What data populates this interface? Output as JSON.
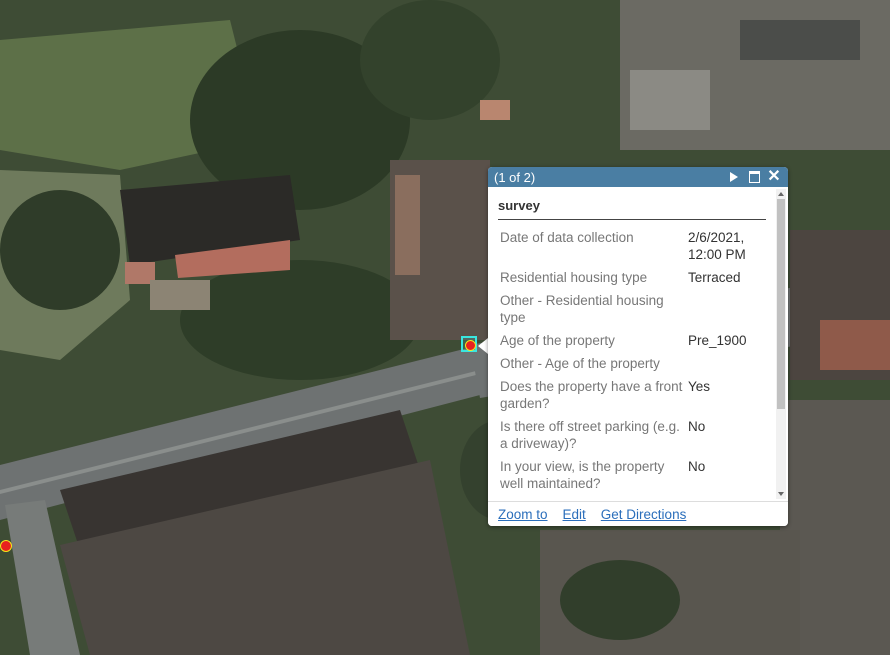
{
  "popup": {
    "count_label": "(1 of 2)",
    "title": "survey",
    "fields": [
      {
        "label": "Date of data collection",
        "value": "2/6/2021, 12:00 PM"
      },
      {
        "label": "Residential housing type",
        "value": "Terraced"
      },
      {
        "label": "Other - Residential housing type",
        "value": ""
      },
      {
        "label": "Age of the property",
        "value": "Pre_1900"
      },
      {
        "label": "Other - Age of the property",
        "value": ""
      },
      {
        "label": "Does the property have a front garden?",
        "value": "Yes"
      },
      {
        "label": "Is there off street parking (e.g. a driveway)?",
        "value": "No"
      },
      {
        "label": "In your view, is the property well maintained?",
        "value": "No"
      }
    ],
    "actions": {
      "zoom_to": "Zoom to",
      "edit": "Edit",
      "get_directions": "Get Directions"
    },
    "icons": {
      "next": "play-icon",
      "maximize": "maximize-icon",
      "close": "close-icon"
    }
  },
  "colors": {
    "header": "#4a7ea3",
    "link": "#2a6ebb",
    "marker_fill": "#e8221f",
    "marker_outline": "#f5e81a",
    "selection": "#39e6e0"
  }
}
